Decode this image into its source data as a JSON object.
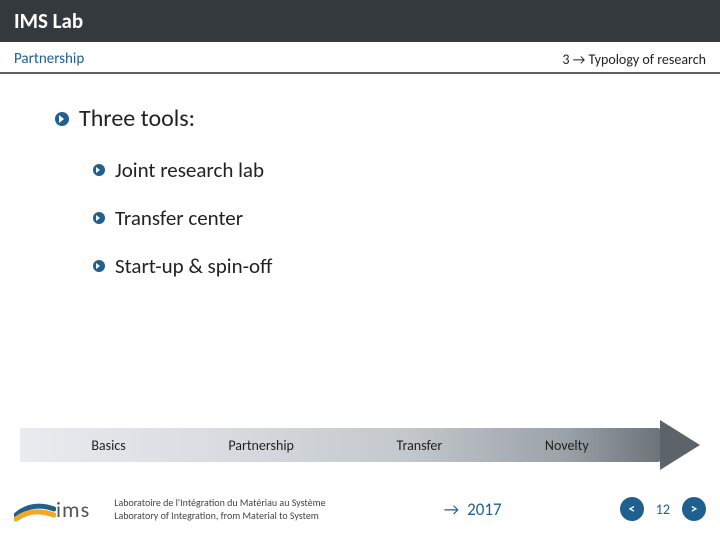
{
  "header": {
    "title": "IMS Lab"
  },
  "subheader": {
    "left": "Partnership",
    "right": "3 → Typology of research"
  },
  "content": {
    "main": "Three tools:",
    "items": [
      "Joint research lab",
      "Transfer center",
      "Start-up & spin-off"
    ]
  },
  "arrow_band": [
    "Basics",
    "Partnership",
    "Transfer",
    "Novelty"
  ],
  "footer": {
    "logo_text": "ims",
    "line1": "Laboratoire de l'Intégration du Matériau au Système",
    "line2": "Laboratory of Integration, from Material to System",
    "arrow": "→",
    "year": "2017",
    "prev": "<",
    "page": "12",
    "next": ">"
  }
}
